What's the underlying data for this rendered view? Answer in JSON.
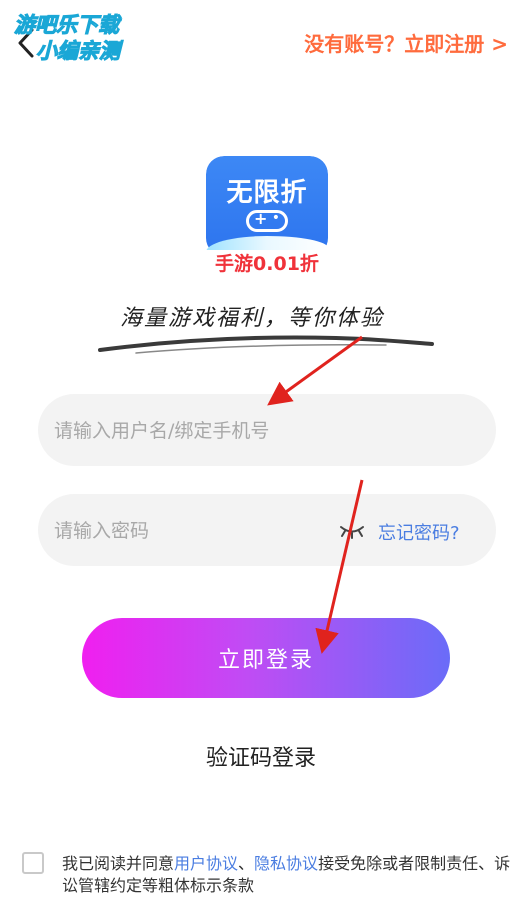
{
  "header": {
    "watermark_line1": "游吧乐下载",
    "watermark_line2": "小编亲测",
    "register_link": "没有账号？立即注册 >"
  },
  "logo": {
    "title": "无限折",
    "subtitle": "手游0.01折"
  },
  "slogan": "海量游戏福利，等你体验",
  "form": {
    "username_placeholder": "请输入用户名/绑定手机号",
    "password_placeholder": "请输入密码",
    "forgot_password": "忘记密码?",
    "login_button": "立即登录",
    "code_login": "验证码登录"
  },
  "agreement": {
    "prefix": "我已阅读并同意",
    "user_agreement": "用户协议",
    "separator": "、",
    "privacy_agreement": "隐私协议",
    "suffix": "接受免除或者限制责任、诉讼管辖约定等粗体标示条款"
  },
  "colors": {
    "accent_link": "#4a7de1",
    "register_orange": "#ff6b3d",
    "annotation_red": "#e0231e",
    "button_gradient_start": "#f01ff0",
    "button_gradient_end": "#6a6cf8"
  },
  "icons": {
    "back": "chevron-left-icon",
    "password_toggle": "closed-eye-icon"
  }
}
